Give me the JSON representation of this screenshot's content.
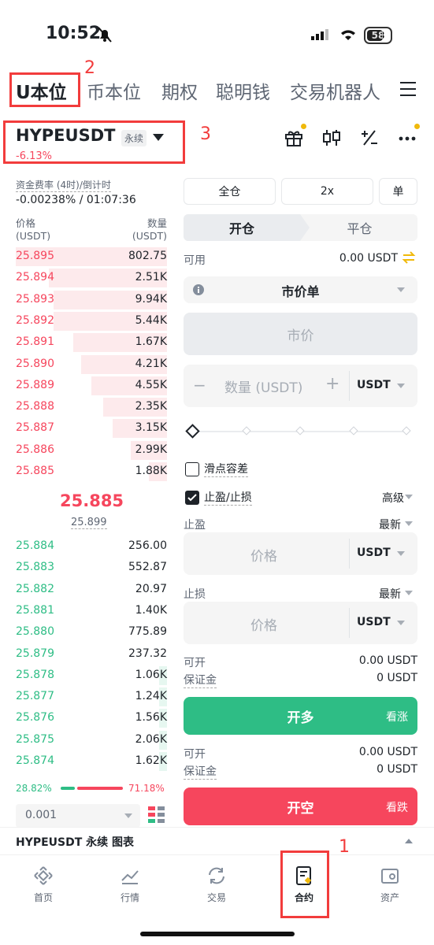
{
  "status_bar": {
    "time": "10:52",
    "battery": "58"
  },
  "tabs": [
    "U本位",
    "币本位",
    "期权",
    "聪明钱",
    "交易机器人"
  ],
  "annotations": {
    "a1": "1",
    "a2": "2",
    "a3": "3"
  },
  "symbol": {
    "name": "HYPEUSDT",
    "type": "永续",
    "change": "-6.13%"
  },
  "funding": {
    "label": "资金费率 (4时)/倒计时",
    "value": "-0.00238% / 01:07:36"
  },
  "orderbook": {
    "price_label": "价格",
    "price_unit": "(USDT)",
    "qty_label": "数量",
    "qty_unit": "(USDT)",
    "asks": [
      {
        "price": "25.895",
        "qty": "802.75",
        "depth": 1.0
      },
      {
        "price": "25.894",
        "qty": "2.51K",
        "depth": 0.78
      },
      {
        "price": "25.893",
        "qty": "9.94K",
        "depth": 0.75
      },
      {
        "price": "25.892",
        "qty": "5.44K",
        "depth": 0.75
      },
      {
        "price": "25.891",
        "qty": "1.67K",
        "depth": 0.62
      },
      {
        "price": "25.890",
        "qty": "4.21K",
        "depth": 0.57
      },
      {
        "price": "25.889",
        "qty": "4.55K",
        "depth": 0.5
      },
      {
        "price": "25.888",
        "qty": "2.35K",
        "depth": 0.42
      },
      {
        "price": "25.887",
        "qty": "3.15K",
        "depth": 0.36
      },
      {
        "price": "25.886",
        "qty": "2.99K",
        "depth": 0.24
      },
      {
        "price": "25.885",
        "qty": "1.88K",
        "depth": 0.12
      }
    ],
    "last_price": "25.885",
    "mark_price": "25.899",
    "bids": [
      {
        "price": "25.884",
        "qty": "256.00",
        "depth": 0.0
      },
      {
        "price": "25.883",
        "qty": "552.87",
        "depth": 0.0
      },
      {
        "price": "25.882",
        "qty": "20.97",
        "depth": 0.0
      },
      {
        "price": "25.881",
        "qty": "1.40K",
        "depth": 0.0
      },
      {
        "price": "25.880",
        "qty": "775.89",
        "depth": 0.0
      },
      {
        "price": "25.879",
        "qty": "237.32",
        "depth": 0.0
      },
      {
        "price": "25.878",
        "qty": "1.06K",
        "depth": 0.05
      },
      {
        "price": "25.877",
        "qty": "1.24K",
        "depth": 0.05
      },
      {
        "price": "25.876",
        "qty": "1.56K",
        "depth": 0.05
      },
      {
        "price": "25.875",
        "qty": "2.06K",
        "depth": 0.05
      },
      {
        "price": "25.874",
        "qty": "1.62K",
        "depth": 0.05
      }
    ],
    "buy_ratio": "28.82%",
    "sell_ratio": "71.18%",
    "precision": "0.001"
  },
  "order_form": {
    "margin_mode": "全仓",
    "leverage": "2x",
    "position_mode": "单",
    "open_tab": "开仓",
    "close_tab": "平仓",
    "available_label": "可用",
    "available_value": "0.00 USDT",
    "order_type": "市价单",
    "price_placeholder": "市价",
    "qty_placeholder": "数量 (USDT)",
    "qty_unit": "USDT",
    "slippage_label": "滑点容差",
    "tpsl_label": "止盈/止损",
    "advanced_label": "高级",
    "tp_label": "止盈",
    "tp_trigger": "最新",
    "tp_price_placeholder": "价格",
    "tp_unit": "USDT",
    "sl_label": "止损",
    "sl_trigger": "最新",
    "sl_price_placeholder": "价格",
    "sl_unit": "USDT",
    "long_open_label": "可开",
    "long_open_value": "0.00 USDT",
    "long_margin_label": "保证金",
    "long_margin_value": "0 USDT",
    "long_button": "开多",
    "long_sub": "看涨",
    "short_open_label": "可开",
    "short_open_value": "0.00 USDT",
    "short_margin_label": "保证金",
    "short_margin_value": "0 USDT",
    "short_button": "开空",
    "short_sub": "看跌"
  },
  "chart_bar": {
    "label": "HYPEUSDT 永续 图表"
  },
  "bottom_nav": [
    "首页",
    "行情",
    "交易",
    "合约",
    "资产"
  ],
  "colors": {
    "up": "#2ebd85",
    "down": "#f6465d",
    "brand": "#f0b90b",
    "annotation": "#f23c3c"
  }
}
